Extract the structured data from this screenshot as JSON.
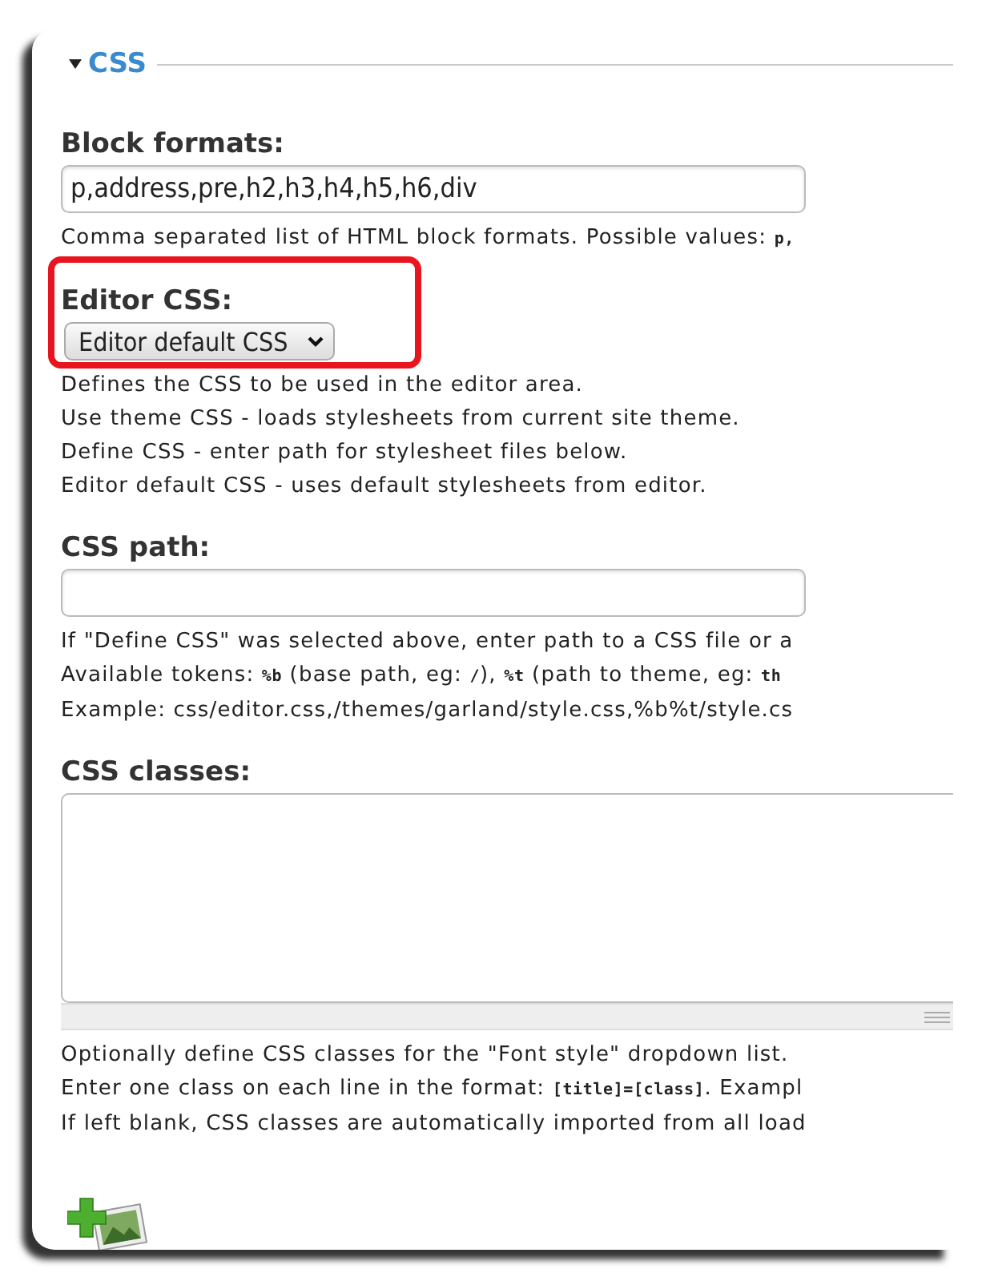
{
  "fieldset": {
    "legend": "CSS",
    "expanded": true
  },
  "fields": [
    {
      "kind": "text",
      "label": "Block formats:",
      "value": "p,address,pre,h2,h3,h4,h5,h6,div",
      "highlighted": false,
      "help": [
        [
          {
            "text": "Comma separated list of HTML block formats. Possible values: "
          },
          {
            "text": "p,",
            "code": true
          }
        ]
      ]
    },
    {
      "kind": "select",
      "label": "Editor CSS:",
      "value": "Editor default CSS",
      "highlighted": true,
      "help": [
        [
          {
            "text": "Defines the CSS to be used in the editor area."
          }
        ],
        [
          {
            "text": "Use theme CSS - loads stylesheets from current site theme."
          }
        ],
        [
          {
            "text": "Define CSS - enter path for stylesheet files below."
          }
        ],
        [
          {
            "text": "Editor default CSS - uses default stylesheets from editor."
          }
        ]
      ]
    },
    {
      "kind": "text",
      "label": "CSS path:",
      "highlighted": false,
      "help": [
        [
          {
            "text": "If \"Define CSS\" was selected above, enter path to a CSS file or a"
          }
        ],
        [
          {
            "text": "Available tokens: "
          },
          {
            "text": "%b",
            "code": true
          },
          {
            "text": " (base path, eg: "
          },
          {
            "text": "/",
            "code": true
          },
          {
            "text": "), "
          },
          {
            "text": "%t",
            "code": true
          },
          {
            "text": " (path to theme, eg: "
          },
          {
            "text": "th",
            "code": true
          }
        ],
        [
          {
            "text": "Example: css/editor.css,/themes/garland/style.css,%b%t/style.cs"
          }
        ]
      ]
    },
    {
      "kind": "textarea",
      "label": "CSS classes:",
      "highlighted": false,
      "help": [
        [
          {
            "text": "Optionally define CSS classes for the \"Font style\" dropdown list."
          }
        ],
        [
          {
            "text": "Enter one class on each line in the format: "
          },
          {
            "text": "[title]=[class]",
            "code": true
          },
          {
            "text": ". Exampl"
          }
        ],
        [
          {
            "text": "If left blank, CSS classes are automatically imported from all load"
          }
        ]
      ]
    }
  ]
}
